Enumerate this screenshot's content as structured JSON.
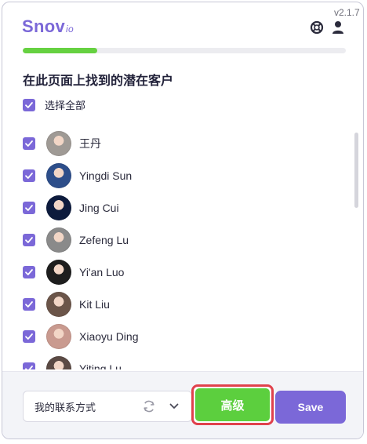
{
  "header": {
    "logo": {
      "main": "Snov",
      "suffix": "io"
    },
    "version": "v2.1.7"
  },
  "progress": {
    "fraction": 0.23,
    "color": "#66d141"
  },
  "main": {
    "title": "在此页面上找到的潜在客户",
    "select_all_label": "选择全部"
  },
  "prospects": [
    {
      "name": "王丹",
      "checked": true,
      "avatar_color": "#9f9a95"
    },
    {
      "name": "Yingdi Sun",
      "checked": true,
      "avatar_color": "#2d4e8a"
    },
    {
      "name": "Jing Cui",
      "checked": true,
      "avatar_color": "#0d1b3d"
    },
    {
      "name": "Zefeng Lu",
      "checked": true,
      "avatar_color": "#8a8a8a"
    },
    {
      "name": "Yi'an Luo",
      "checked": true,
      "avatar_color": "#1e1e1e"
    },
    {
      "name": "Kit Liu",
      "checked": true,
      "avatar_color": "#6b5549"
    },
    {
      "name": "Xiaoyu Ding",
      "checked": true,
      "avatar_color": "#c99a8f"
    },
    {
      "name": "Yiting Lu",
      "checked": true,
      "avatar_color": "#5b4a44"
    }
  ],
  "footer": {
    "dropdown_label": "我的联系方式",
    "advanced_label": "高级",
    "save_label": "Save"
  },
  "colors": {
    "brand": "#7b68d8",
    "accent_green": "#5ccf3e",
    "highlight_red": "#e0414c"
  },
  "icons": {
    "help": "lifebuoy-icon",
    "user": "user-icon",
    "refresh": "refresh-icon",
    "dropdown": "chevron-down-icon",
    "check": "check-icon"
  }
}
